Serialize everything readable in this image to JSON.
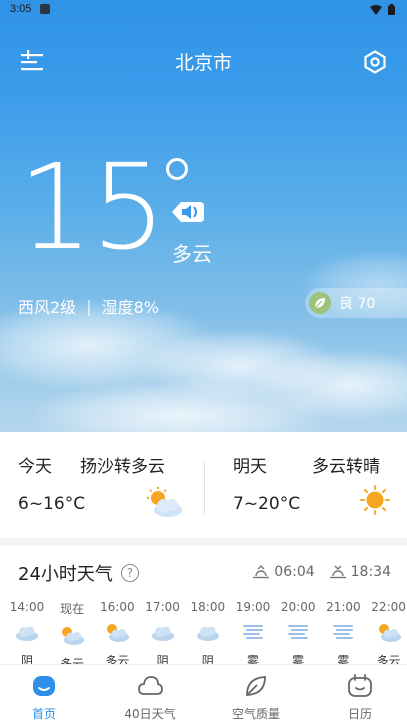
{
  "status": {
    "time": "3:05"
  },
  "header": {
    "city": "北京市"
  },
  "current": {
    "temperature": "15",
    "condition": "多云",
    "wind": "西风2级",
    "separator": "|",
    "humidity": "湿度8%",
    "aqi_label": "良 70"
  },
  "forecast": {
    "today": {
      "label": "今天",
      "desc": "扬沙转多云",
      "range": "6~16°C",
      "icon": "partly-cloudy-icon"
    },
    "tomorrow": {
      "label": "明天",
      "desc": "多云转晴",
      "range": "7~20°C",
      "icon": "sun-icon"
    }
  },
  "hourly": {
    "title": "24小时天气",
    "help": "?",
    "sunrise": "06:04",
    "sunset": "18:34",
    "hours": [
      {
        "time": "14:00",
        "cond": "阴",
        "icon": "cloud"
      },
      {
        "time": "现在",
        "cond": "多云",
        "icon": "partly"
      },
      {
        "time": "16:00",
        "cond": "多云",
        "icon": "partly"
      },
      {
        "time": "17:00",
        "cond": "阴",
        "icon": "cloud"
      },
      {
        "time": "18:00",
        "cond": "阴",
        "icon": "cloud"
      },
      {
        "time": "19:00",
        "cond": "雾",
        "icon": "fog"
      },
      {
        "time": "20:00",
        "cond": "雾",
        "icon": "fog"
      },
      {
        "time": "21:00",
        "cond": "雾",
        "icon": "fog"
      },
      {
        "time": "22:00",
        "cond": "多云",
        "icon": "partly"
      }
    ]
  },
  "tabs": [
    {
      "label": "首页",
      "active": true
    },
    {
      "label": "40日天气",
      "active": false
    },
    {
      "label": "空气质量",
      "active": false
    },
    {
      "label": "日历",
      "active": false
    }
  ],
  "colors": {
    "accent": "#2d8fe8",
    "sun": "#f7a623",
    "aqi_good": "#9bc37c"
  }
}
